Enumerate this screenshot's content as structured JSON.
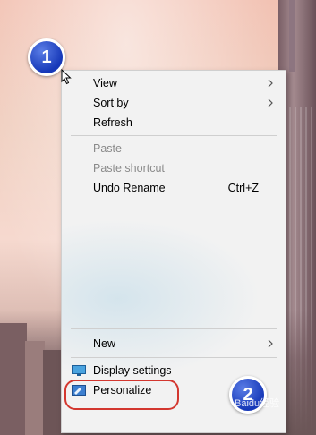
{
  "menu": {
    "items": [
      {
        "label": "View",
        "submenu": true
      },
      {
        "label": "Sort by",
        "submenu": true
      },
      {
        "label": "Refresh"
      },
      {
        "label": "Paste",
        "disabled": true
      },
      {
        "label": "Paste shortcut",
        "disabled": true
      },
      {
        "label": "Undo Rename",
        "shortcut": "Ctrl+Z"
      },
      {
        "label": "New",
        "submenu": true
      },
      {
        "label": "Display settings",
        "icon": "display-settings-icon"
      },
      {
        "label": "Personalize",
        "icon": "personalize-icon"
      }
    ]
  },
  "badges": {
    "step1": "1",
    "step2": "2"
  },
  "watermark": "Baidu经验",
  "colors": {
    "highlight": "#d3372f",
    "badge": "#1638b8",
    "menu_bg": "#f2f2f2"
  }
}
